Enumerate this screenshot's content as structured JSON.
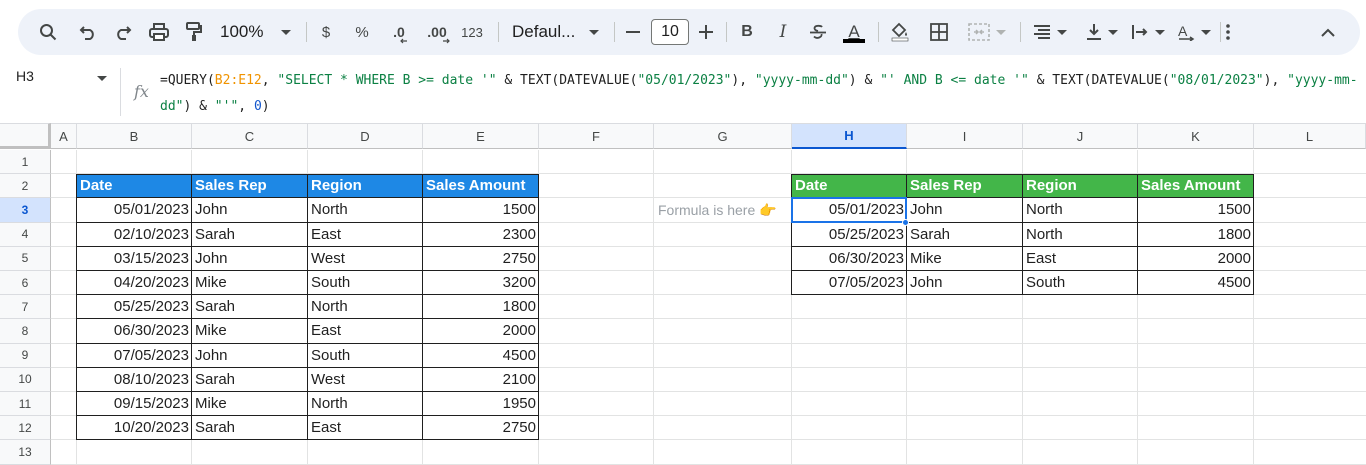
{
  "toolbar": {
    "zoom": "100%",
    "currency": "$",
    "percent": "%",
    "dec_decrease": ".0",
    "dec_increase": ".00",
    "number_format": "123",
    "font_name": "Defaul...",
    "font_size": "10",
    "bold": "B",
    "italic": "I",
    "text_color": "A"
  },
  "formula_bar": {
    "cell_ref": "H3",
    "fx": "fx",
    "parts": [
      "=QUERY(",
      "B2:E12",
      ", ",
      "\"SELECT * WHERE B >= date '\"",
      " & TEXT(DATEVALUE(",
      "\"05/01/2023\"",
      "), ",
      "\"yyyy-mm-dd\"",
      ") & ",
      "\"' AND B <= date '\"",
      " & TEXT(DATEVALUE(",
      "\"08/01/2023\"",
      "), ",
      "\"yyyy-mm-dd\"",
      ") & ",
      "\"'\"",
      ", ",
      "0",
      ")"
    ]
  },
  "columns": [
    "A",
    "B",
    "C",
    "D",
    "E",
    "F",
    "G",
    "H",
    "I",
    "J",
    "K",
    "L"
  ],
  "rows": [
    "1",
    "2",
    "3",
    "4",
    "5",
    "6",
    "7",
    "8",
    "9",
    "10",
    "11",
    "12",
    "13"
  ],
  "source_table": {
    "headers": [
      "Date",
      "Sales Rep",
      "Region",
      "Sales Amount"
    ],
    "rows": [
      [
        "05/01/2023",
        "John",
        "North",
        "1500"
      ],
      [
        "02/10/2023",
        "Sarah",
        "East",
        "2300"
      ],
      [
        "03/15/2023",
        "John",
        "West",
        "2750"
      ],
      [
        "04/20/2023",
        "Mike",
        "South",
        "3200"
      ],
      [
        "05/25/2023",
        "Sarah",
        "North",
        "1800"
      ],
      [
        "06/30/2023",
        "Mike",
        "East",
        "2000"
      ],
      [
        "07/05/2023",
        "John",
        "South",
        "4500"
      ],
      [
        "08/10/2023",
        "Sarah",
        "West",
        "2100"
      ],
      [
        "09/15/2023",
        "Mike",
        "North",
        "1950"
      ],
      [
        "10/20/2023",
        "Sarah",
        "East",
        "2750"
      ]
    ]
  },
  "note": "Formula is here 👉",
  "result_table": {
    "headers": [
      "Date",
      "Sales Rep",
      "Region",
      "Sales Amount"
    ],
    "rows": [
      [
        "05/01/2023",
        "John",
        "North",
        "1500"
      ],
      [
        "05/25/2023",
        "Sarah",
        "North",
        "1800"
      ],
      [
        "06/30/2023",
        "Mike",
        "East",
        "2000"
      ],
      [
        "07/05/2023",
        "John",
        "South",
        "4500"
      ]
    ]
  },
  "colors": {
    "source_header": "#1e88e5",
    "result_header": "#43b649",
    "selection": "#1a73e8"
  }
}
